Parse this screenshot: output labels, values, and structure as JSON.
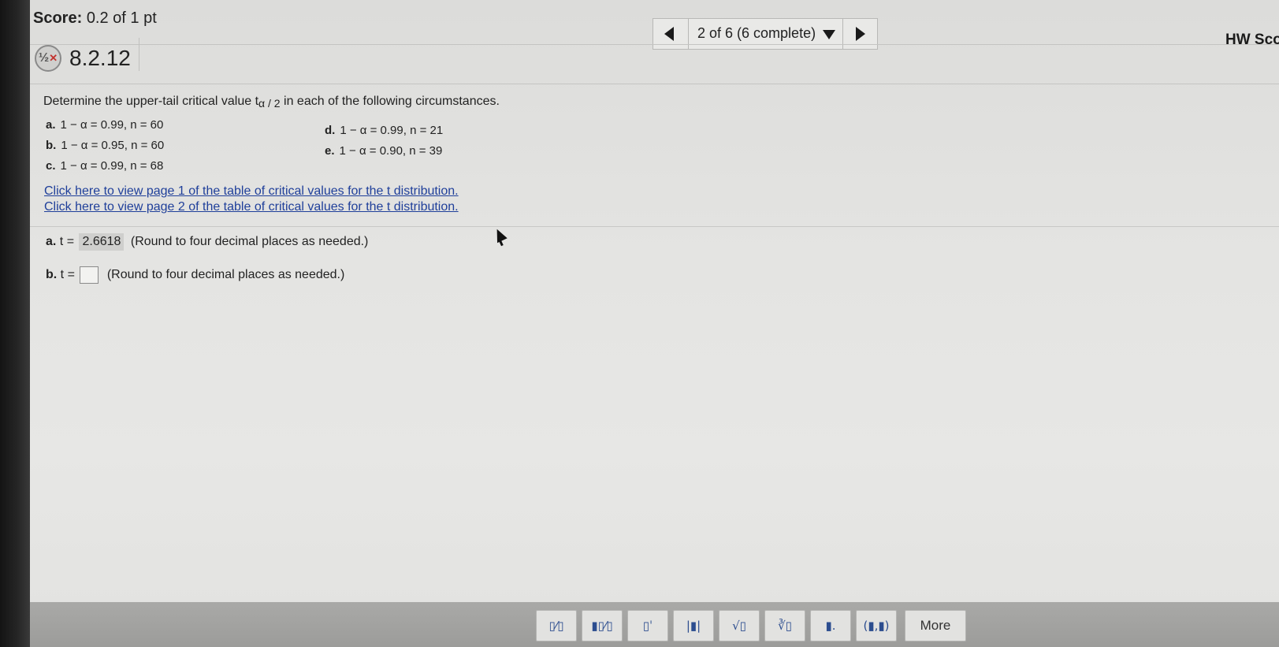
{
  "header": {
    "score_label": "Score:",
    "score_value": "0.2 of 1 pt",
    "nav_text": "2 of 6 (6 complete)",
    "hw_score_label": "HW Sco"
  },
  "question": {
    "number": "8.2.12",
    "icon_text": "½",
    "prompt_before": "Determine the upper-tail critical value t",
    "prompt_sub": "α / 2",
    "prompt_after": " in each of the following circumstances.",
    "items": [
      {
        "label": "a.",
        "text": "1 − α = 0.99, n = 60"
      },
      {
        "label": "b.",
        "text": "1 − α = 0.95, n = 60"
      },
      {
        "label": "c.",
        "text": "1 − α = 0.99, n = 68"
      },
      {
        "label": "d.",
        "text": "1 − α = 0.99, n = 21"
      },
      {
        "label": "e.",
        "text": "1 − α = 0.90, n = 39"
      }
    ],
    "links": [
      "Click here to view page 1 of the table of critical values for the t distribution.",
      "Click here to view page 2 of the table of critical values for the t distribution."
    ]
  },
  "answers": {
    "a": {
      "label": "a.",
      "prefix": "t =",
      "value": "2.6618",
      "hint": "(Round to four decimal places as needed.)"
    },
    "b": {
      "label": "b.",
      "prefix": "t =",
      "value": "",
      "hint": "(Round to four decimal places as needed.)"
    }
  },
  "toolbar": {
    "buttons": [
      {
        "icon": "fraction-icon",
        "glyph": "▯⁄▯"
      },
      {
        "icon": "mixed-number-icon",
        "glyph": "▮▯⁄▯"
      },
      {
        "icon": "exponent-icon",
        "glyph": "▯ˈ"
      },
      {
        "icon": "absolute-value-icon",
        "glyph": "|▮|"
      },
      {
        "icon": "square-root-icon",
        "glyph": "√▯"
      },
      {
        "icon": "nth-root-icon",
        "glyph": "∛▯"
      },
      {
        "icon": "decimal-icon",
        "glyph": "▮."
      },
      {
        "icon": "interval-icon",
        "glyph": "(▮,▮)"
      }
    ],
    "more_label": "More"
  }
}
